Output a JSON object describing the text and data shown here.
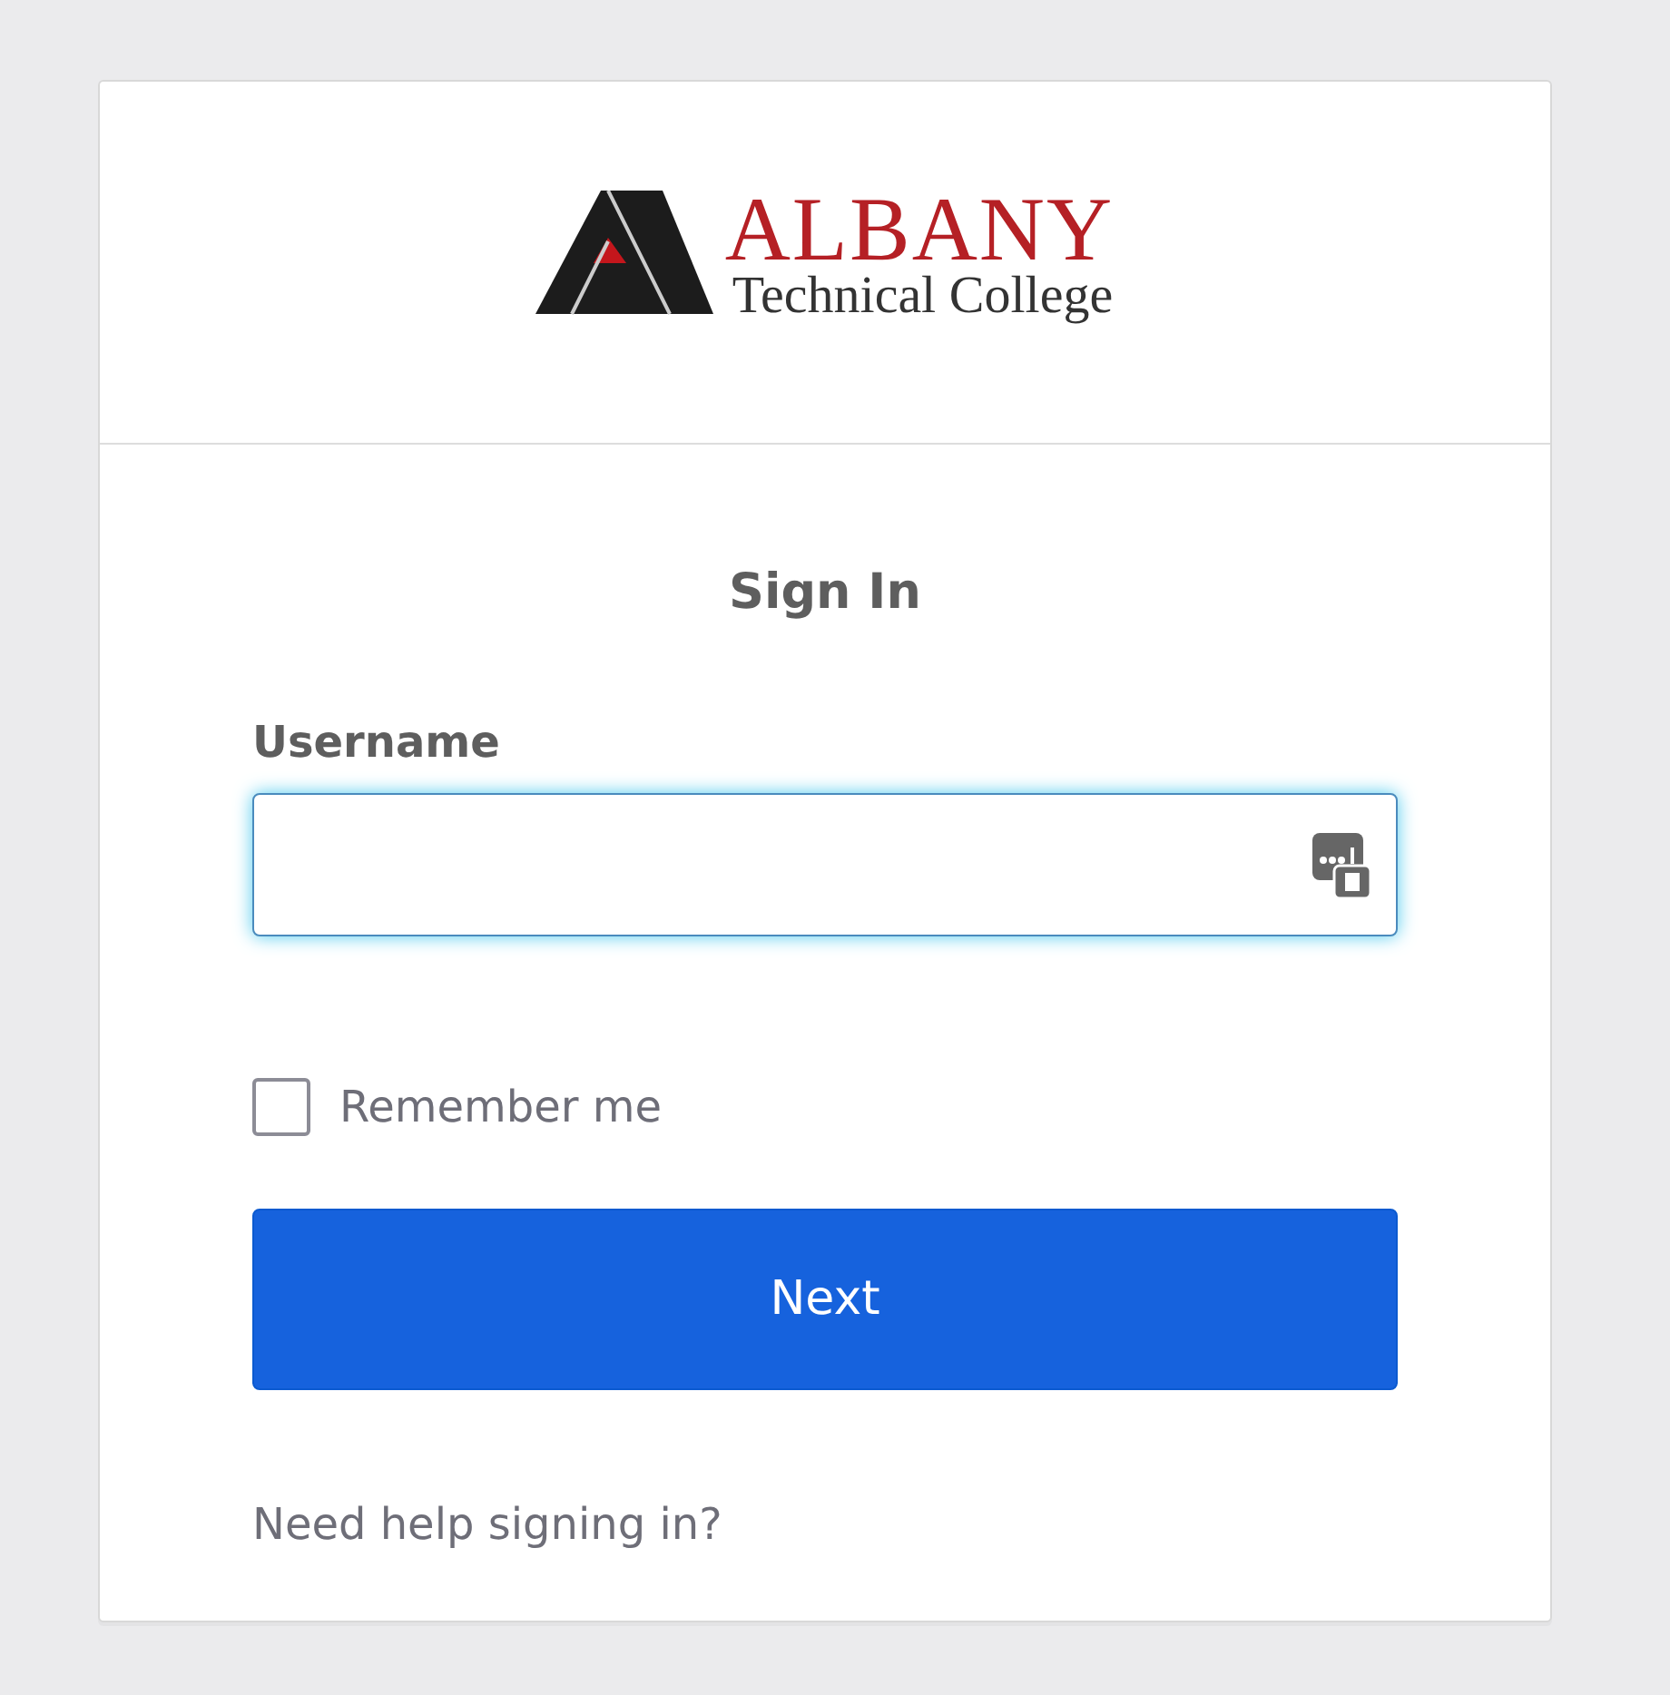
{
  "logo": {
    "name": "ALBANY",
    "subtitle": "Technical College"
  },
  "form": {
    "title": "Sign In",
    "username": {
      "label": "Username",
      "focused": true
    },
    "remember": {
      "label": "Remember me",
      "checked": false
    },
    "submit": "Next",
    "help_link": "Need help signing in?"
  }
}
